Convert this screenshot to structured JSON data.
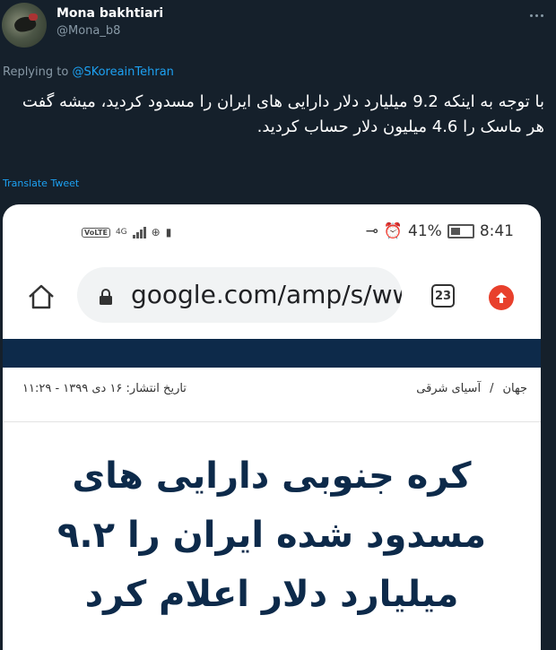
{
  "tweet": {
    "display_name": "Mona bakhtiari",
    "handle": "@Mona_b8",
    "replying_prefix": "Replying to",
    "replying_to": "@SKoreainTehran",
    "text": "با توجه به اینکه 9.2 میلیارد دلار دارایی های ایران را مسدود کردید، میشه گفت هر ماسک را 4.6 میلیون دلار حساب کردید.",
    "translate_label": "Translate Tweet"
  },
  "phone": {
    "status_left_badge": "VoLTE",
    "network": "4G",
    "battery_percent": "41%",
    "time": "8:41"
  },
  "browser": {
    "url": "google.com/amp/s/www",
    "tab_count": "23"
  },
  "article": {
    "breadcrumb_home": "جهان",
    "breadcrumb_sep": "/",
    "breadcrumb_section": "آسیای شرقی",
    "publish_date": "تاریخ انتشار: ۱۶ دی ۱۳۹۹ - ۱۱:۲۹",
    "headline": "کره جنوبی دارایی های مسدود شده ایران را ۹.۲ میلیارد دلار اعلام کرد"
  },
  "colors": {
    "background": "#15202b",
    "link": "#1da1f2",
    "muted": "#8899a6",
    "headline": "#0d2a4a"
  }
}
